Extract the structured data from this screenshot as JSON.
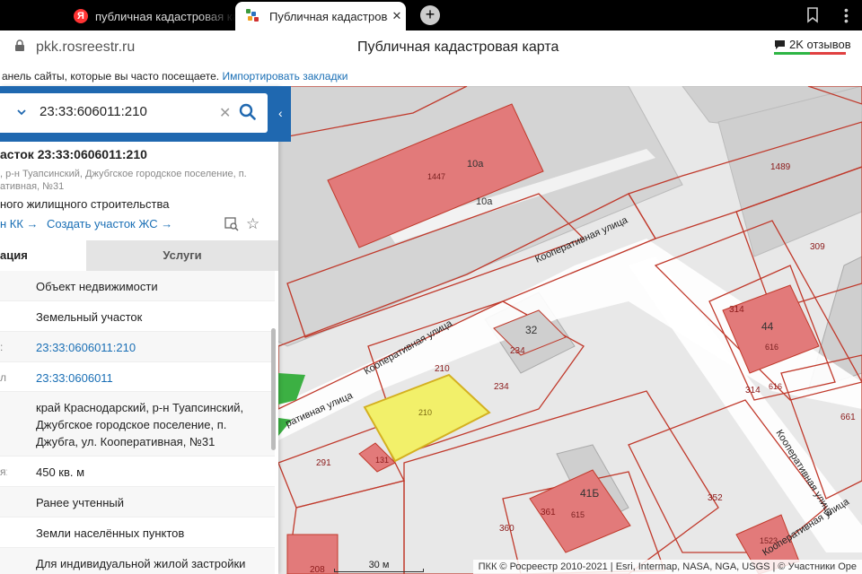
{
  "browser": {
    "tabs": [
      {
        "title": "публичная кадастровая ка",
        "icon": "yandex-icon",
        "active": false
      },
      {
        "title": "Публичная кадастровая",
        "icon": "pkk-logo-icon",
        "active": true
      }
    ],
    "new_tab_label": "+",
    "url": "pkk.rosreestr.ru",
    "page_title": "Публичная кадастровая карта",
    "reviews": "2K отзывов",
    "bookmarks_hint": "анель сайты, которые вы часто посещаете.",
    "import_bookmarks": "Импортировать закладки"
  },
  "search": {
    "value": "23:33:606011:210",
    "clear_label": "✕"
  },
  "object": {
    "title": "асток 23:33:0606011:210",
    "address_short": ", р-н Туапсинский, Джубгское городское поселение, п. ативная, №31",
    "purpose": "ного жилищного строительства",
    "link_kk": "н КК →",
    "link_create_zhs": "Создать участок ЖС →"
  },
  "tabs": {
    "info": "ация",
    "services": "Услуги"
  },
  "rows": [
    {
      "label": "",
      "value": "Объект недвижимости",
      "link": false
    },
    {
      "label": "",
      "value": "Земельный участок",
      "link": false
    },
    {
      "label": ":",
      "value": "23:33:0606011:210",
      "link": true
    },
    {
      "label": "л:",
      "value": "23:33:0606011",
      "link": true
    },
    {
      "label": "",
      "value": "край Краснодарский, р-н Туапсинский, Джубгское городское поселение, п. Джубга, ул. Кооперативная, №31",
      "link": false
    },
    {
      "label": "я:",
      "value": "450 кв. м",
      "link": false
    },
    {
      "label": "",
      "value": "Ранее учтенный",
      "link": false
    },
    {
      "label": "",
      "value": "Земли населённых пунктов",
      "link": false
    },
    {
      "label": "",
      "value": "Для индивидуальной жилой застройки",
      "link": false
    }
  ],
  "map": {
    "street_name": "Кооперативная улица",
    "labels": [
      "10а",
      "1447",
      "10а",
      "1489",
      "309",
      "314",
      "44",
      "616",
      "314",
      "616",
      "32",
      "234",
      "234",
      "210",
      "210",
      "661",
      "291",
      "131",
      "41Б",
      "361",
      "615",
      "352",
      "360",
      "1523",
      "208"
    ],
    "scale_label": "30 м",
    "attribution": "ПКК © Росреестр 2010-2021 | Esri, Intermap, NASA, NGA, USGS | © Участники Оре",
    "colors": {
      "parcel_outline": "#c0392b",
      "building_fill": "#e27a7a",
      "selected_fill": "#f2f06a",
      "selected_outline": "#d4b020",
      "road": "#ffffff",
      "block": "#cfcfcf"
    }
  }
}
